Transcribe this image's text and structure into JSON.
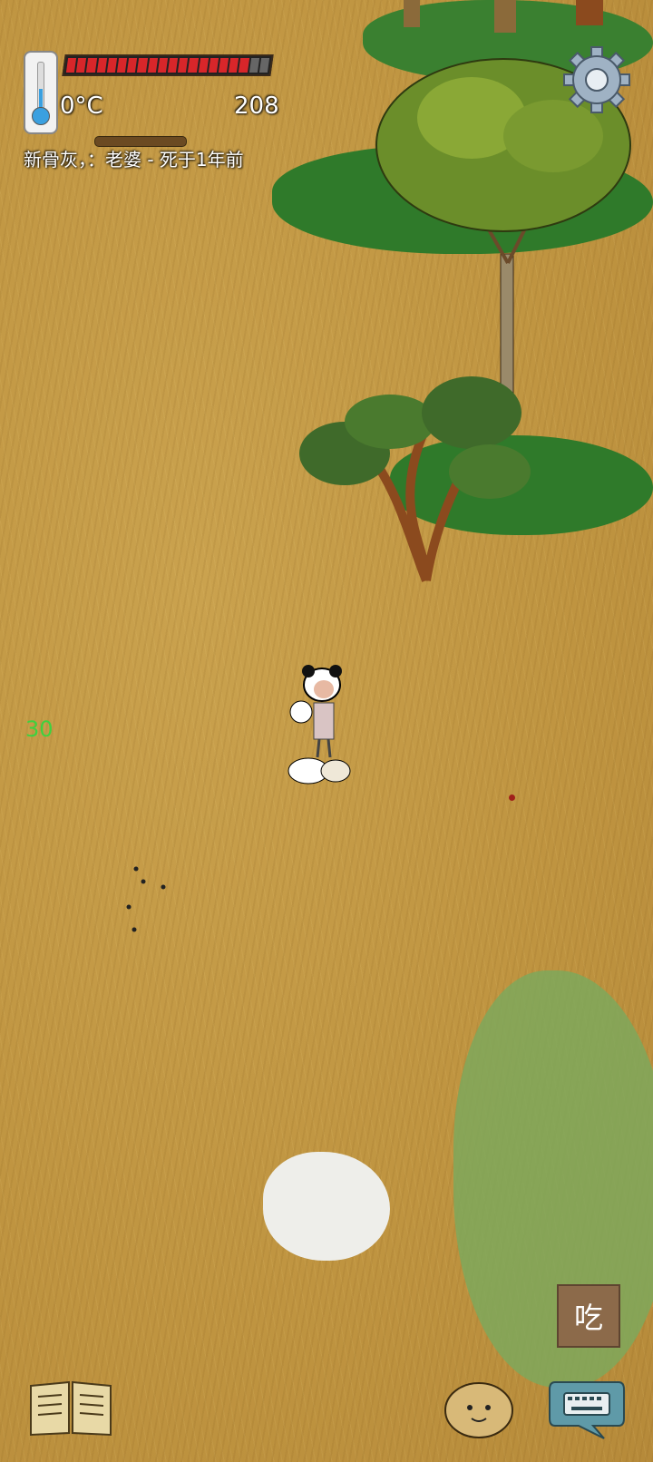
{
  "hud": {
    "temperature": "0°C",
    "food_value": "208",
    "food_fill_fraction": 0.9,
    "death_note": "新骨灰，：老婆 - 死于1年前",
    "age_indicator": "30"
  },
  "buttons": {
    "eat_label": "吃"
  },
  "icons": {
    "thermometer": "thermometer-icon",
    "settings": "gear-icon",
    "journal": "book-icon",
    "emote": "face-icon",
    "keyboard": "keyboard-icon"
  },
  "colors": {
    "ground": "#c49a45",
    "food_pip": "#d8262a",
    "age_text": "#3fd13f"
  }
}
